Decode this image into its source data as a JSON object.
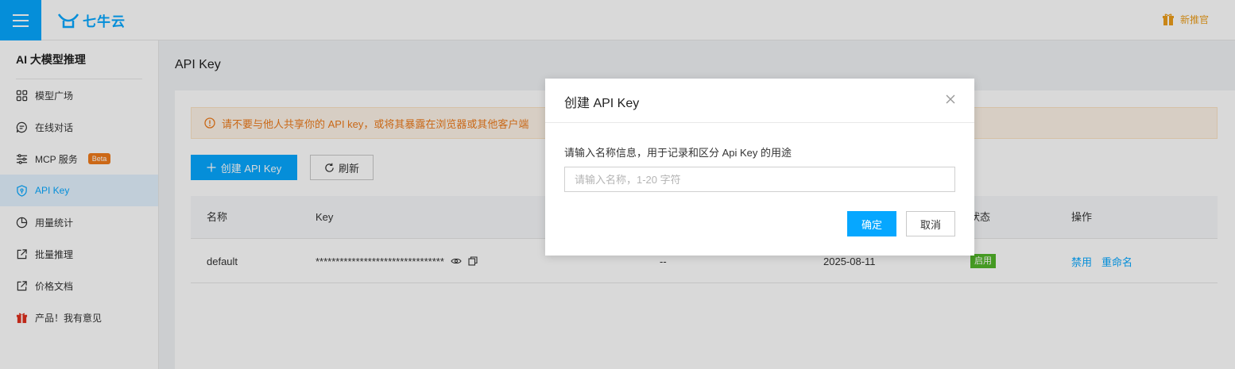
{
  "topbar": {
    "logo_text": "七牛云",
    "recommend_label": "新推官"
  },
  "sidebar": {
    "title": "AI 大模型推理",
    "items": [
      {
        "label": "模型广场",
        "icon": "grid-icon"
      },
      {
        "label": "在线对话",
        "icon": "chat-icon"
      },
      {
        "label": "MCP 服务",
        "icon": "sliders-icon",
        "badge": "Beta"
      },
      {
        "label": "API Key",
        "icon": "shield-key-icon",
        "active": true
      },
      {
        "label": "用量统计",
        "icon": "pie-chart-icon"
      },
      {
        "label": "批量推理",
        "icon": "external-link-icon"
      },
      {
        "label": "价格文档",
        "icon": "external-link-icon"
      },
      {
        "label": "产品！我有意见",
        "icon": "gift-icon"
      }
    ]
  },
  "page": {
    "title": "API Key",
    "alert_text": "请不要与他人共享你的 API key，或将其暴露在浏览器或其他客户端",
    "create_button": "创建 API Key",
    "refresh_button": "刷新"
  },
  "table": {
    "columns": [
      "名称",
      "Key",
      "状态",
      "操作"
    ],
    "rows": [
      {
        "name": "default",
        "key": "********************************",
        "dash": "--",
        "date": "2025-08-11",
        "status": "启用",
        "actions": [
          "禁用",
          "重命名"
        ]
      }
    ]
  },
  "modal": {
    "title": "创建 API Key",
    "description": "请输入名称信息，用于记录和区分 Api Key 的用途",
    "input_placeholder": "请输入名称，1-20 字符",
    "input_value": "",
    "ok_button": "确定",
    "cancel_button": "取消"
  },
  "colors": {
    "primary": "#06a7ff",
    "warning": "#ed7b1c",
    "success": "#52b52a",
    "beta": "#f07b1a"
  }
}
